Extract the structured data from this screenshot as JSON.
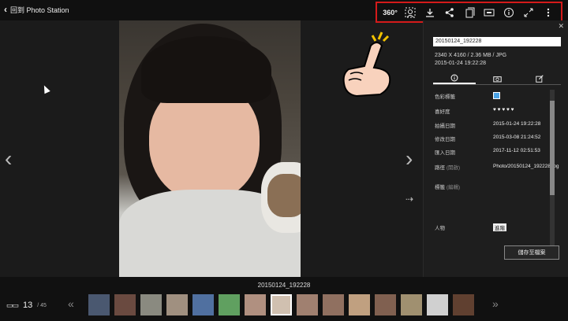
{
  "header": {
    "back_label": "回到 Photo Station"
  },
  "toolbar": {
    "items": [
      {
        "name": "360-view-button",
        "icon": "360",
        "label": "360°"
      },
      {
        "name": "face-button",
        "icon": "face-icon"
      },
      {
        "name": "download-button",
        "icon": "download-icon"
      },
      {
        "name": "share-button",
        "icon": "share-icon"
      },
      {
        "name": "copy-button",
        "icon": "copy-icon"
      },
      {
        "name": "slideshow-button",
        "icon": "slideshow-icon"
      },
      {
        "name": "info-button",
        "icon": "info-icon"
      },
      {
        "name": "fullscreen-button",
        "icon": "fullscreen-icon"
      },
      {
        "name": "more-button",
        "icon": "more-icon"
      }
    ],
    "highlight_color": "#d41a1a"
  },
  "panel": {
    "filename_value": "20150124_192228",
    "dimensions": "2340 X 4160 / 2.36 MB / JPG",
    "datetime": "2015-01-24 19:22:28",
    "tabs": [
      "info-icon",
      "camera-icon",
      "edit-icon"
    ],
    "fields": [
      {
        "label": "色彩標籤",
        "value": ""
      },
      {
        "label": "喜好度",
        "value": "♥ ♥ ♥ ♥ ♥"
      },
      {
        "label": "拍攝日期",
        "value": "2015-01-24 19:22:28"
      },
      {
        "label": "修改日期",
        "value": "2015-03-08 21:24:52"
      },
      {
        "label": "匯入日期",
        "value": "2017-11-12 02:51:53"
      },
      {
        "label": "路徑",
        "hint": "(開啟)",
        "value": "Photo/20150124_192228.jpg"
      },
      {
        "label": "標籤",
        "hint": "(編輯)",
        "value": ""
      },
      {
        "label": "人物",
        "value": "",
        "tag": "進階"
      }
    ],
    "save_label": "儲存至檔案",
    "color_tag": "#4aa3e6"
  },
  "filmstrip": {
    "title": "20150124_192228",
    "current": "13",
    "total": "/ 45",
    "thumb_colors": [
      "#4a5870",
      "#6a4a40",
      "#8a8a80",
      "#a09080",
      "#5070a0",
      "#60a060",
      "#b09080",
      "#d0c0b0",
      "#a08070",
      "#907060",
      "#c0a080",
      "#806050",
      "#a09070",
      "#d0d0d0",
      "#604030"
    ],
    "selected_index": 7
  }
}
